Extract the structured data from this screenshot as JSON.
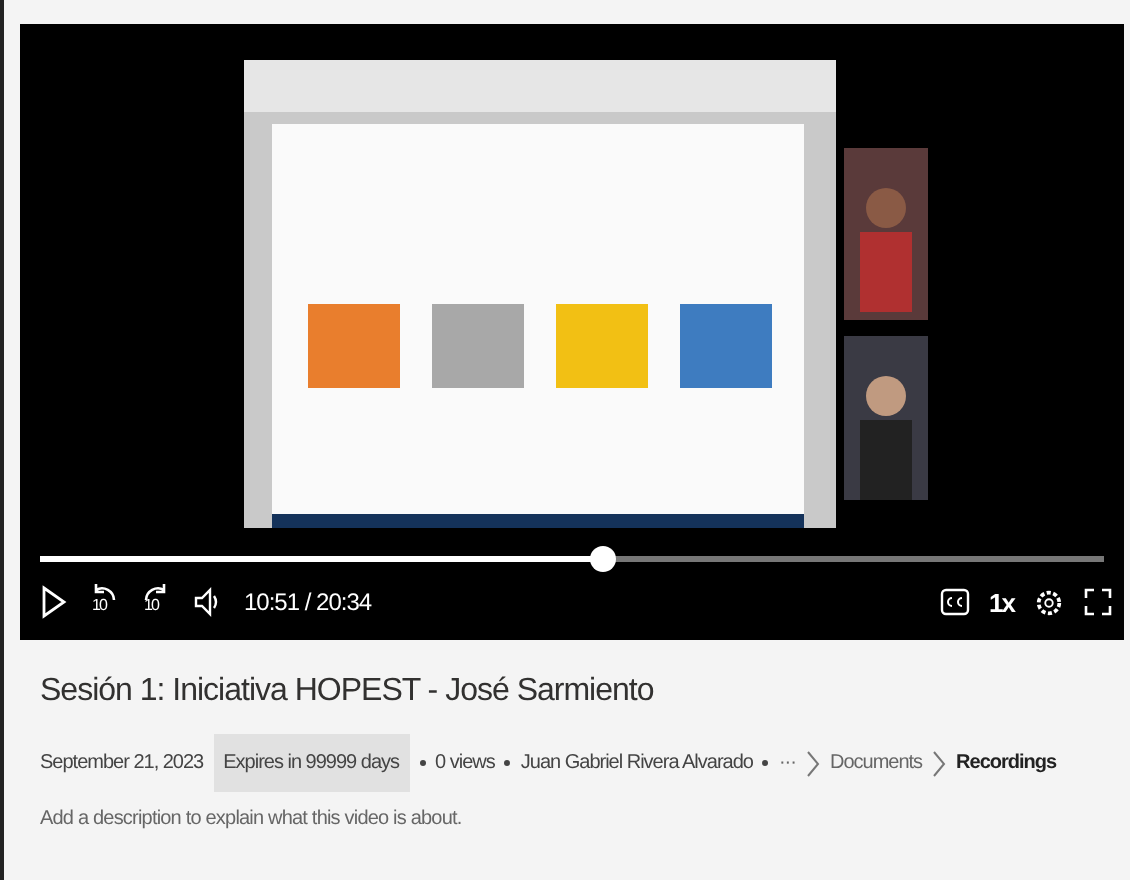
{
  "player": {
    "progress": {
      "level": 0.528
    },
    "rewind_label": "10",
    "forward_label": "10",
    "time": "10:51 / 20:34",
    "speed": "1x"
  },
  "title": "Sesión 1: Iniciativa HOPEST - José Sarmiento",
  "meta": {
    "date": "September 21, 2023",
    "expiry": "Expires in 99999 days",
    "views": "0 views",
    "author": "Juan Gabriel Rivera Alvarado"
  },
  "breadcrumb": [
    {
      "label": "···",
      "current": false
    },
    {
      "label": "Documents",
      "current": false
    },
    {
      "label": "Recordings",
      "current": true
    }
  ],
  "description": {
    "placeholder": "Add a description to explain what this video is about."
  }
}
